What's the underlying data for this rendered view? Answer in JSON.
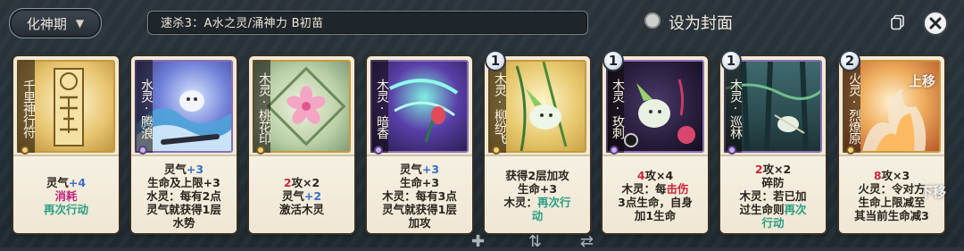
{
  "header": {
    "stage_label": "化神期",
    "strategy_text": "速杀3：A水之灵/涌神力 B初苗",
    "cover_label": "设为封面"
  },
  "icons": {
    "stage": "chevron-down-icon",
    "copy": "copy-icon",
    "close": "close-icon",
    "cover": "radio-icon"
  },
  "colors": {
    "blue": "#3b6fc4",
    "red": "#c8263a",
    "pink": "#c2237d",
    "green": "#2a9d84"
  },
  "cards": [
    {
      "name": "千里神行符",
      "badge": "",
      "lines": [
        [
          {
            "t": "灵气"
          },
          {
            "t": "+4",
            "c": "blue"
          }
        ],
        [
          {
            "t": "消耗",
            "c": "pink"
          }
        ],
        [
          {
            "t": "再次行动",
            "c": "green"
          }
        ]
      ]
    },
    {
      "name": "水灵·腾浪",
      "badge": "",
      "lines": [
        [
          {
            "t": "灵气"
          },
          {
            "t": "+3",
            "c": "blue"
          }
        ],
        [
          {
            "t": "生命及上限+3"
          }
        ],
        [
          {
            "t": "水灵：每有2点"
          }
        ],
        [
          {
            "t": "灵气就获得1层"
          }
        ],
        [
          {
            "t": "水势"
          }
        ]
      ]
    },
    {
      "name": "木灵·桃花印",
      "badge": "",
      "lines": [
        [
          {
            "t": "2",
            "c": "red"
          },
          {
            "t": "攻×2"
          }
        ],
        [
          {
            "t": "灵气"
          },
          {
            "t": "+2",
            "c": "blue"
          }
        ],
        [
          {
            "t": "激活木灵"
          }
        ]
      ]
    },
    {
      "name": "木灵·暗香",
      "badge": "",
      "lines": [
        [
          {
            "t": "灵气"
          },
          {
            "t": "+3",
            "c": "blue"
          }
        ],
        [
          {
            "t": "生命+3"
          }
        ],
        [
          {
            "t": "木灵：每有3点"
          }
        ],
        [
          {
            "t": "灵气就获得1层"
          }
        ],
        [
          {
            "t": "加攻"
          }
        ]
      ]
    },
    {
      "name": "木灵·柳纷飞",
      "badge": "1",
      "lines": [
        [
          {
            "t": "获得2层加攻"
          }
        ],
        [
          {
            "t": "生命+3"
          }
        ],
        [
          {
            "t": "木灵："
          },
          {
            "t": "再次行",
            "c": "green"
          }
        ],
        [
          {
            "t": "动",
            "c": "green"
          }
        ]
      ]
    },
    {
      "name": "木灵·玫刺",
      "badge": "1",
      "lines": [
        [
          {
            "t": "4",
            "c": "red"
          },
          {
            "t": "攻×4"
          }
        ],
        [
          {
            "t": "木灵：每"
          },
          {
            "t": "击伤",
            "c": "red"
          }
        ],
        [
          {
            "t": "3点生命，自身"
          }
        ],
        [
          {
            "t": "加1生命"
          }
        ]
      ]
    },
    {
      "name": "木灵·巡林",
      "badge": "1",
      "lines": [
        [
          {
            "t": "2",
            "c": "red"
          },
          {
            "t": "攻×2"
          }
        ],
        [
          {
            "t": "碎防"
          }
        ],
        [
          {
            "t": "木灵：若已加"
          }
        ],
        [
          {
            "t": "过生命则"
          },
          {
            "t": "再次",
            "c": "green"
          }
        ],
        [
          {
            "t": "行动",
            "c": "green"
          }
        ]
      ]
    },
    {
      "name": "火灵·烈燎原",
      "badge": "2",
      "lines": [
        [
          {
            "t": "8",
            "c": "red"
          },
          {
            "t": "攻×3"
          }
        ],
        [
          {
            "t": "火灵：令对方"
          }
        ],
        [
          {
            "t": "生命上限减至"
          }
        ],
        [
          {
            "t": "其当前生命减3"
          }
        ]
      ]
    }
  ],
  "overlay": {
    "move_up": "上移",
    "move_down": "下移"
  }
}
